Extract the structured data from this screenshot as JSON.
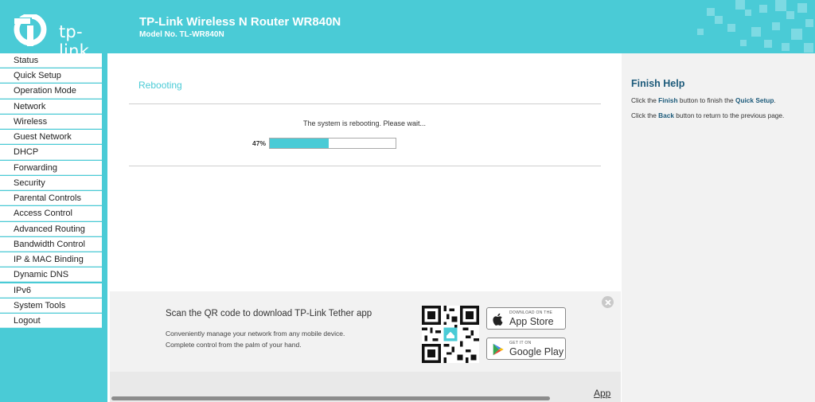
{
  "header": {
    "brand": "tp-link",
    "title": "TP-Link Wireless N Router WR840N",
    "model": "Model No. TL-WR840N"
  },
  "sidebar": {
    "items": [
      {
        "label": "Status"
      },
      {
        "label": "Quick Setup"
      },
      {
        "label": "Operation Mode"
      },
      {
        "label": "Network"
      },
      {
        "label": "Wireless"
      },
      {
        "label": "Guest Network"
      },
      {
        "label": "DHCP"
      },
      {
        "label": "Forwarding"
      },
      {
        "label": "Security"
      },
      {
        "label": "Parental Controls"
      },
      {
        "label": "Access Control"
      },
      {
        "label": "Advanced Routing"
      },
      {
        "label": "Bandwidth Control"
      },
      {
        "label": "IP & MAC Binding"
      },
      {
        "label": "Dynamic DNS"
      },
      {
        "label": "IPv6"
      },
      {
        "label": "System Tools"
      },
      {
        "label": "Logout"
      }
    ]
  },
  "main": {
    "title": "Rebooting",
    "message": "The system is rebooting. Please wait...",
    "progress_label": "47%",
    "progress": 0.47
  },
  "banner": {
    "title": "Scan the QR code to download TP-Link Tether app",
    "line1": "Conveniently manage your network from any mobile device.",
    "line2": "Complete control from the palm of your hand.",
    "app_store_small": "DOWNLOAD ON THE",
    "app_store_big": "App Store",
    "google_play_small": "GET IT ON",
    "google_play_big": "Google Play"
  },
  "help": {
    "title": "Finish Help",
    "line1_pre": "Click the ",
    "line1_key": "Finish",
    "line1_mid": " button to finish the ",
    "line1_key2": "Quick Setup",
    "line1_post": ".",
    "line2_pre": "Click the ",
    "line2_key": "Back",
    "line2_post": " button to return to the previous page."
  },
  "footer": {
    "app_link": "App"
  },
  "colors": {
    "accent": "#4acbd6",
    "help_title": "#1c5a7a"
  }
}
